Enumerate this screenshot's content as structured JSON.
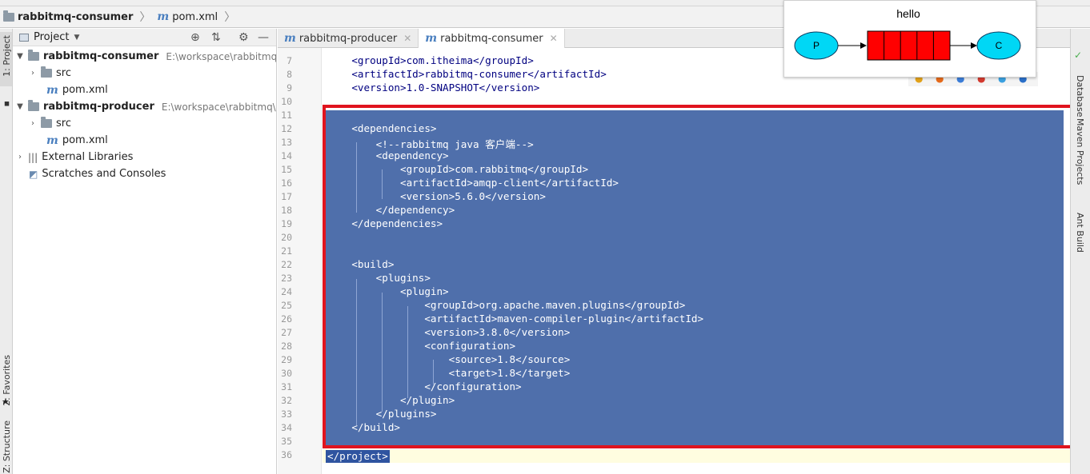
{
  "breadcrumb": {
    "project": "rabbitmq-consumer",
    "file": "pom.xml"
  },
  "tool_strip_left": {
    "project": "1: Project",
    "favorites": "2: Favorites",
    "structure": "Z: Structure"
  },
  "tool_strip_right": {
    "database": "Database",
    "maven": "Maven Projects",
    "ant": "Ant Build"
  },
  "project_panel": {
    "title": "Project",
    "tree": [
      {
        "label": "rabbitmq-consumer",
        "path": "E:\\workspace\\rabbitmq\\rab"
      },
      {
        "label": "src"
      },
      {
        "label": "pom.xml"
      },
      {
        "label": "rabbitmq-producer",
        "path": "E:\\workspace\\rabbitmq\\rabb"
      },
      {
        "label": "src"
      },
      {
        "label": "pom.xml"
      },
      {
        "label": "External Libraries"
      },
      {
        "label": "Scratches and Consoles"
      }
    ]
  },
  "editor": {
    "tabs": [
      {
        "label": "rabbitmq-producer",
        "active": false
      },
      {
        "label": "rabbitmq-consumer",
        "active": true
      }
    ],
    "lines": [
      {
        "n": "7",
        "t": "    <groupId>com.itheima</groupId>"
      },
      {
        "n": "8",
        "t": "    <artifactId>rabbitmq-consumer</artifactId>"
      },
      {
        "n": "9",
        "t": "    <version>1.0-SNAPSHOT</version>"
      },
      {
        "n": "10",
        "t": ""
      },
      {
        "n": "11",
        "t": ""
      },
      {
        "n": "12",
        "t": "    <dependencies>"
      },
      {
        "n": "13",
        "t": "        <!--rabbitmq java 客户端-->"
      },
      {
        "n": "14",
        "t": "        <dependency>"
      },
      {
        "n": "15",
        "t": "            <groupId>com.rabbitmq</groupId>"
      },
      {
        "n": "16",
        "t": "            <artifactId>amqp-client</artifactId>"
      },
      {
        "n": "17",
        "t": "            <version>5.6.0</version>"
      },
      {
        "n": "18",
        "t": "        </dependency>"
      },
      {
        "n": "19",
        "t": "    </dependencies>"
      },
      {
        "n": "20",
        "t": ""
      },
      {
        "n": "21",
        "t": ""
      },
      {
        "n": "22",
        "t": "    <build>"
      },
      {
        "n": "23",
        "t": "        <plugins>"
      },
      {
        "n": "24",
        "t": "            <plugin>"
      },
      {
        "n": "25",
        "t": "                <groupId>org.apache.maven.plugins</groupId>"
      },
      {
        "n": "26",
        "t": "                <artifactId>maven-compiler-plugin</artifactId>"
      },
      {
        "n": "27",
        "t": "                <version>3.8.0</version>"
      },
      {
        "n": "28",
        "t": "                <configuration>"
      },
      {
        "n": "29",
        "t": "                    <source>1.8</source>"
      },
      {
        "n": "30",
        "t": "                    <target>1.8</target>"
      },
      {
        "n": "31",
        "t": "                </configuration>"
      },
      {
        "n": "32",
        "t": "            </plugin>"
      },
      {
        "n": "33",
        "t": "        </plugins>"
      },
      {
        "n": "34",
        "t": "    </build>"
      },
      {
        "n": "35",
        "t": ""
      },
      {
        "n": "36",
        "t": "</project>"
      }
    ]
  },
  "diagram": {
    "title": "hello",
    "producer": "P",
    "consumer": "C",
    "colors": {
      "node": "#00d7f5",
      "queue": "#ff0000"
    }
  },
  "colors": {
    "selection": "#4f6fab",
    "highlight_box": "#e0141e"
  }
}
